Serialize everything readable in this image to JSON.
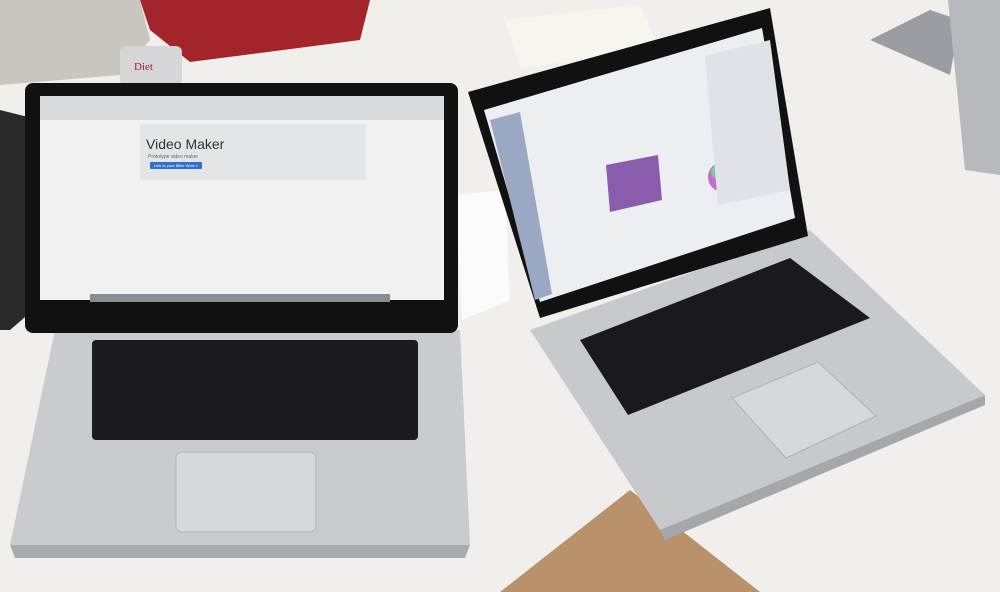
{
  "left_laptop": {
    "page_heading": "Video Maker",
    "page_subtitle": "Prototype video maker",
    "primary_button": "Link to your Biller Wow »"
  },
  "right_laptop": {
    "app": "document editor with color picker palette"
  },
  "objects": {
    "can_label": "Diet"
  },
  "colors": {
    "desk": "#f2f1ee",
    "laptop_body": "#c9cbce",
    "keyboard": "#1b1b1d",
    "screen_bezel": "#111",
    "cardboard": "#b9916a"
  }
}
